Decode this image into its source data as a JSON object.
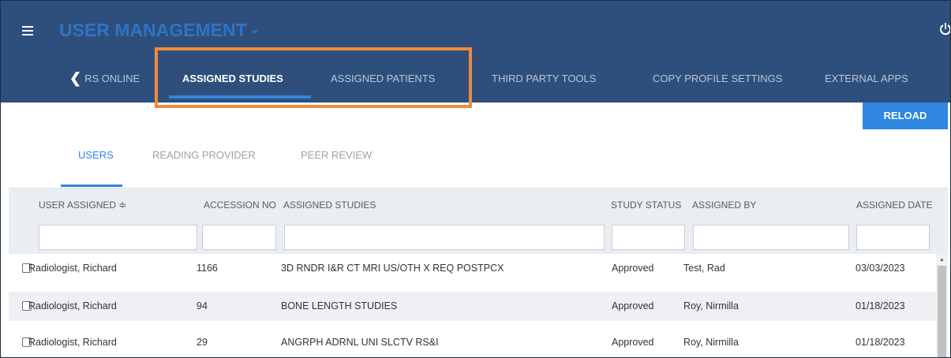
{
  "header": {
    "title": "USER MANAGEMENT -",
    "menu_icon": "hamburger-menu-icon",
    "power_icon": "power-icon",
    "colors": {
      "bg": "#2e4f7c",
      "title": "#2e74c4",
      "accent": "#2f86e0",
      "highlight": "#f08a3a"
    }
  },
  "tabs": [
    {
      "label": "RS ONLINE",
      "active": false,
      "icon": "chevron-left-icon"
    },
    {
      "label": "ASSIGNED STUDIES",
      "active": true
    },
    {
      "label": "ASSIGNED PATIENTS",
      "active": false
    },
    {
      "label": "THIRD PARTY TOOLS",
      "active": false
    },
    {
      "label": "COPY PROFILE SETTINGS",
      "active": false
    },
    {
      "label": "EXTERNAL APPS",
      "active": false
    }
  ],
  "toolbar": {
    "reload_label": "RELOAD"
  },
  "subtabs": [
    {
      "label": "USERS",
      "active": true
    },
    {
      "label": "READING PROVIDER",
      "active": false
    },
    {
      "label": "PEER REVIEW",
      "active": false
    }
  ],
  "grid": {
    "columns": [
      {
        "label": "USER ASSIGNED ≑",
        "sort_icon": "sort-icon"
      },
      {
        "label": "ACCESSION NO"
      },
      {
        "label": "ASSIGNED STUDIES"
      },
      {
        "label": "STUDY STATUS"
      },
      {
        "label": "ASSIGNED BY"
      },
      {
        "label": "ASSIGNED DATE"
      }
    ],
    "rows": [
      {
        "user": "Radiologist, Richard",
        "accession": "1166",
        "study": "3D RNDR I&R CT MRI US/OTH X REQ POSTPCX",
        "status": "Approved",
        "assigned_by": "Test, Rad",
        "date": "03/03/2023"
      },
      {
        "user": "Radiologist, Richard",
        "accession": "94",
        "study": "BONE LENGTH STUDIES",
        "status": "Approved",
        "assigned_by": "Roy, Nirmilla",
        "date": "01/18/2023"
      },
      {
        "user": "Radiologist, Richard",
        "accession": "29",
        "study": "ANGRPH ADRNL UNI SLCTV RS&I",
        "status": "Approved",
        "assigned_by": "Roy, Nirmilla",
        "date": "01/18/2023"
      }
    ]
  }
}
